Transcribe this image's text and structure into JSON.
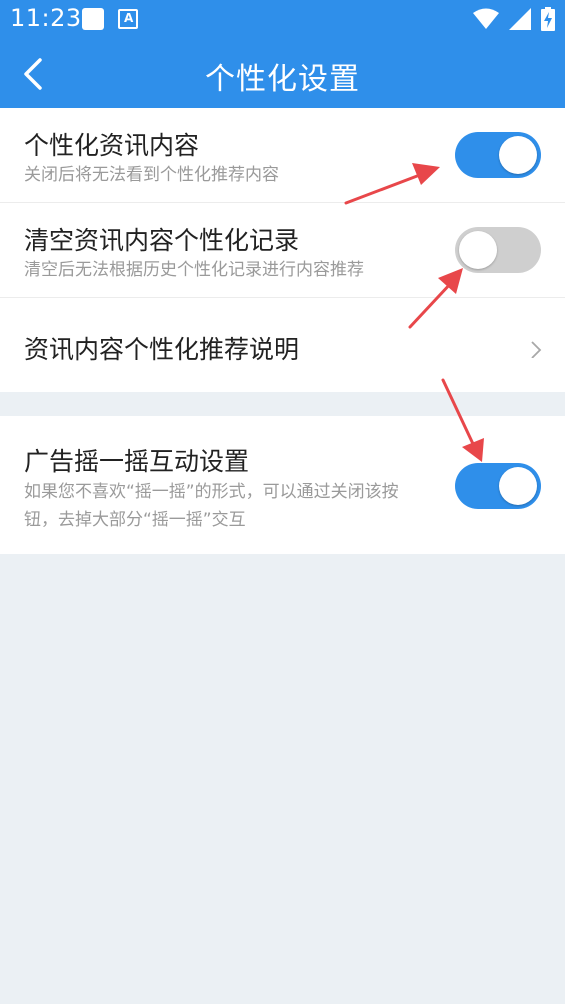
{
  "status_bar": {
    "time": "11:23",
    "notif_icon_label": "A"
  },
  "app_bar": {
    "title": "个性化设置"
  },
  "settings": {
    "personalized_content": {
      "title": "个性化资讯内容",
      "subtitle": "关闭后将无法看到个性化推荐内容",
      "enabled": true
    },
    "clear_records": {
      "title": "清空资讯内容个性化记录",
      "subtitle": "清空后无法根据历史个性化记录进行内容推荐",
      "enabled": false
    },
    "explanation": {
      "title": "资讯内容个性化推荐说明"
    },
    "shake_ad": {
      "title": "广告摇一摇互动设置",
      "subtitle_line1": "如果您不喜欢“摇一摇”的形式，可以通过关闭该按",
      "subtitle_line2": "钮，去掉大部分“摇一摇”交互",
      "enabled": true
    }
  },
  "colors": {
    "accent": "#2f8fea",
    "toggle_off": "#cfcfcf",
    "annotation_arrow": "#e8474a",
    "background": "#ebf0f4"
  }
}
